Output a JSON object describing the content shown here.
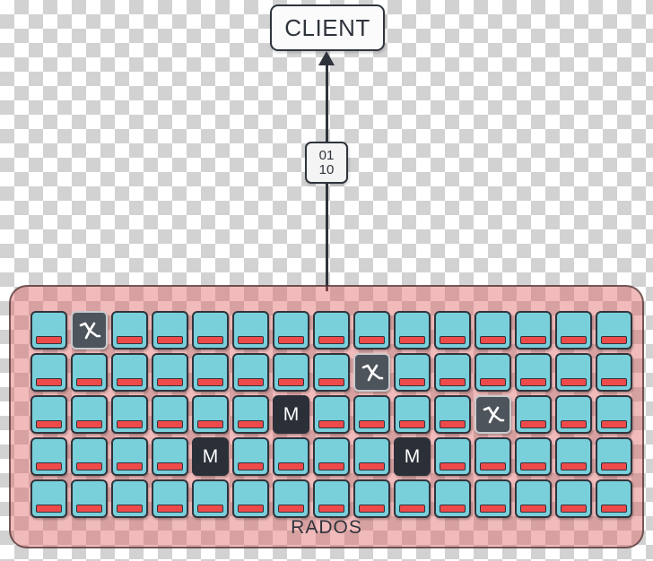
{
  "diagram": {
    "client": {
      "label": "CLIENT"
    },
    "data_packet": {
      "line1": "01",
      "line2": "10"
    },
    "connector": {
      "arrow_icon": "arrow-up-icon",
      "direction": "up"
    },
    "rados": {
      "label": "RADOS",
      "colors": {
        "panel_fill": "#e05d5d",
        "node_fill": "#79cfda",
        "disk_bar": "#ef4a4a",
        "monitor_fill": "#2b3038",
        "gateway_fill": "#4e545c",
        "outline": "#2f343c"
      },
      "columns": 15,
      "rows": 5,
      "node_types": {
        "osd": "storage-node",
        "mon": "monitor-node",
        "gw": "gateway-node"
      },
      "grid": [
        [
          "osd",
          "gw",
          "osd",
          "osd",
          "osd",
          "osd",
          "osd",
          "osd",
          "osd",
          "osd",
          "osd",
          "osd",
          "osd",
          "osd",
          "osd"
        ],
        [
          "osd",
          "osd",
          "osd",
          "osd",
          "osd",
          "osd",
          "osd",
          "osd",
          "gw",
          "osd",
          "osd",
          "osd",
          "osd",
          "osd",
          "osd"
        ],
        [
          "osd",
          "osd",
          "osd",
          "osd",
          "osd",
          "osd",
          "mon",
          "osd",
          "osd",
          "osd",
          "osd",
          "gw",
          "osd",
          "osd",
          "osd"
        ],
        [
          "osd",
          "osd",
          "osd",
          "osd",
          "mon",
          "osd",
          "osd",
          "osd",
          "osd",
          "mon",
          "osd",
          "osd",
          "osd",
          "osd",
          "osd"
        ],
        [
          "osd",
          "osd",
          "osd",
          "osd",
          "osd",
          "osd",
          "osd",
          "osd",
          "osd",
          "osd",
          "osd",
          "osd",
          "osd",
          "osd",
          "osd"
        ]
      ],
      "monitor_letter": "M",
      "gateway_icon": "lambda-gateway-icon"
    }
  }
}
